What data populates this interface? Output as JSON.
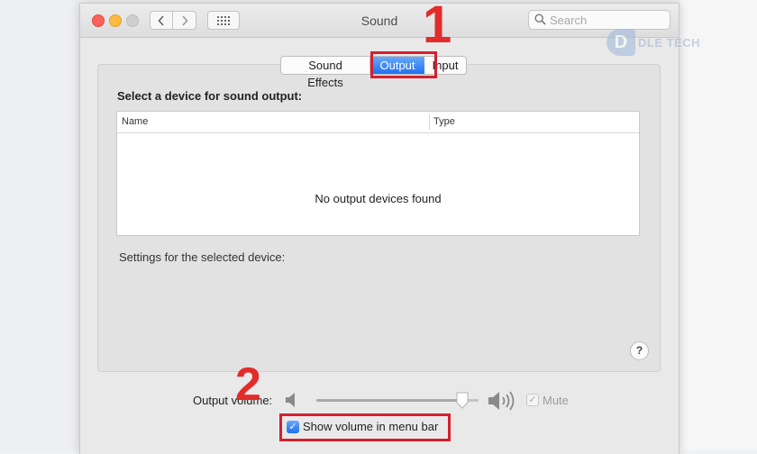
{
  "window": {
    "title": "Sound"
  },
  "toolbar": {
    "search_placeholder": "Search"
  },
  "watermark": {
    "mark": "D",
    "text": "DLE TECH"
  },
  "tabs": [
    {
      "label": "Sound Effects",
      "selected": false
    },
    {
      "label": "Output",
      "selected": true
    },
    {
      "label": "Input",
      "selected": false
    }
  ],
  "output": {
    "heading": "Select a device for sound output:",
    "columns": [
      "Name",
      "Type"
    ],
    "empty_message": "No output devices found",
    "settings_label": "Settings for the selected device:"
  },
  "help": {
    "label": "?"
  },
  "volume": {
    "label": "Output volume:",
    "level": 0.9,
    "mute_label": "Mute",
    "mute_checked": true
  },
  "menu_bar": {
    "label": "Show volume in menu bar",
    "checked": true
  },
  "annotations": {
    "step1": "1",
    "step2": "2",
    "color": "#d3202f"
  },
  "colors": {
    "accent": "#1e71f1",
    "annotation": "#e32b2b"
  }
}
